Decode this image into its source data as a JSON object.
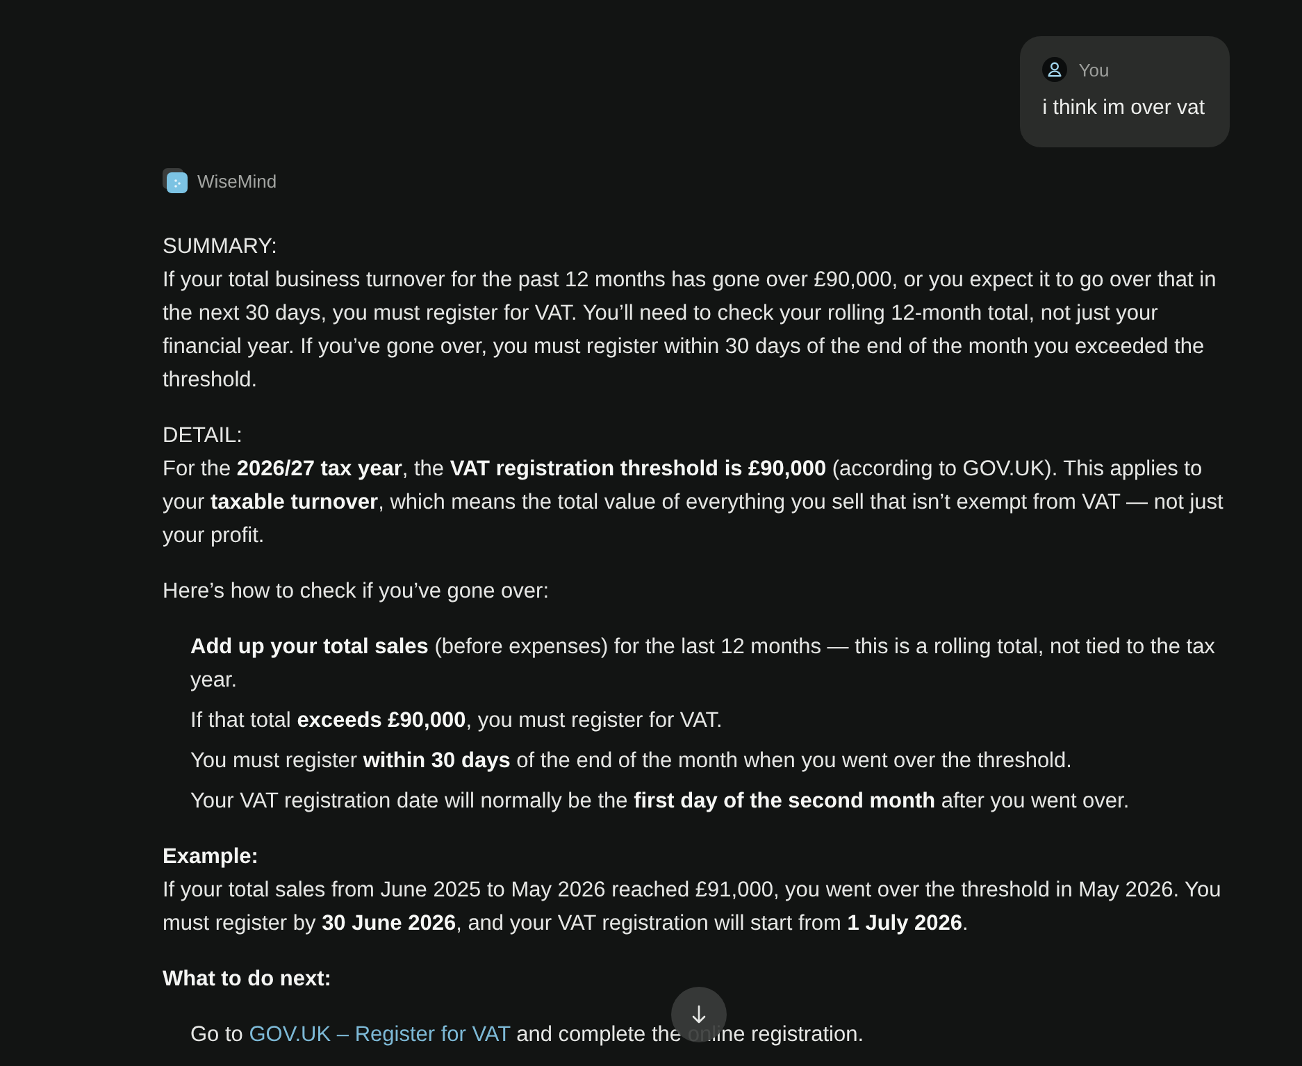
{
  "user_message": {
    "author": "You",
    "text": "i think im over vat"
  },
  "assistant": {
    "name": "WiseMind"
  },
  "response": [
    {
      "kind": "section",
      "heading": "SUMMARY:",
      "heading_bold": false,
      "text": "If your total business turnover for the past 12 months has gone over £90,000, or you expect it to go over that in the next 30 days, you must register for VAT. You’ll need to check your rolling 12-month total, not just your financial year. If you’ve gone over, you must register within 30 days of the end of the month you exceeded the threshold."
    },
    {
      "kind": "section",
      "heading": "DETAIL:",
      "heading_bold": false,
      "text": "For the **2026/27 tax year**, the **VAT registration threshold is £90,000** (according to GOV.UK). This applies to your **taxable turnover**, which means the total value of everything you sell that isn’t exempt from VAT — not just your profit."
    },
    {
      "kind": "paragraph",
      "bold": false,
      "text": "Here’s how to check if you’ve gone over:"
    },
    {
      "kind": "list",
      "items": [
        {
          "text": "**Add up your total sales** (before expenses) for the last 12 months — this is a rolling total, not tied to the tax year."
        },
        {
          "text": "If that total **exceeds £90,000**, you must register for VAT."
        },
        {
          "text": "You must register **within 30 days** of the end of the month when you went over the threshold."
        },
        {
          "text": "Your VAT registration date will normally be the **first day of the second month** after you went over."
        }
      ]
    },
    {
      "kind": "section",
      "heading": "Example:",
      "heading_bold": true,
      "text": "If your total sales from June 2025 to May 2026 reached £91,000, you went over the threshold in May 2026. You must register by **30 June 2026**, and your VAT registration will start from **1 July 2026**."
    },
    {
      "kind": "paragraph",
      "bold": true,
      "text": "What to do next:"
    },
    {
      "kind": "list",
      "items": [
        {
          "text": "Go to ",
          "link": "GOV.UK – Register for VAT",
          "after": " and complete the online registration."
        }
      ]
    }
  ]
}
